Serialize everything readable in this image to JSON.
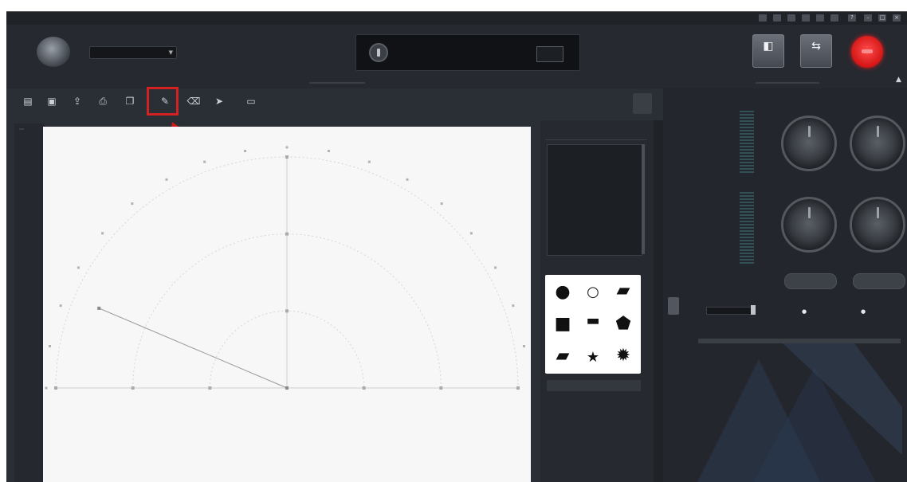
{
  "window": {
    "title": ""
  },
  "top_bar": {
    "preset_value": "",
    "buttons": [
      {
        "name": "stop-button",
        "label": ""
      },
      {
        "name": "mode-button",
        "label": ""
      }
    ]
  },
  "toolbar": {
    "tools": [
      {
        "name": "open-tool",
        "label": ""
      },
      {
        "name": "save-tool",
        "label": ""
      },
      {
        "name": "export-tool",
        "label": ""
      },
      {
        "name": "print-tool",
        "label": ""
      },
      {
        "name": "copy-tool",
        "label": ""
      },
      {
        "name": "draw-tool",
        "label": ""
      },
      {
        "name": "erase-tool",
        "label": ""
      },
      {
        "name": "pointer-tool",
        "label": ""
      },
      {
        "name": "settings-tool",
        "label": ""
      }
    ],
    "highlighted_tool": "draw-tool"
  },
  "chart_data": {
    "type": "polar",
    "r_max": 6,
    "r_rings": [
      2,
      4,
      6
    ],
    "angular_ticks_deg": [
      10,
      20,
      30,
      40,
      50,
      60,
      70,
      80,
      90,
      100,
      110,
      120,
      130,
      140,
      150,
      160,
      170,
      180
    ],
    "series": [
      {
        "points": [
          {
            "angle_deg": 0,
            "r": 0
          },
          {
            "angle_deg": 157,
            "r": 5.3
          }
        ]
      }
    ],
    "grid": true
  },
  "shapes_panel": {
    "shapes": [
      "circle-filled",
      "circle-outline",
      "tag",
      "square",
      "bar",
      "pentagon",
      "parallelogram",
      "star",
      "burst"
    ]
  },
  "colors": {
    "background": "#2a2e35",
    "record": "#e02020",
    "highlight": "#d32020",
    "meter": "#3c6e74"
  }
}
